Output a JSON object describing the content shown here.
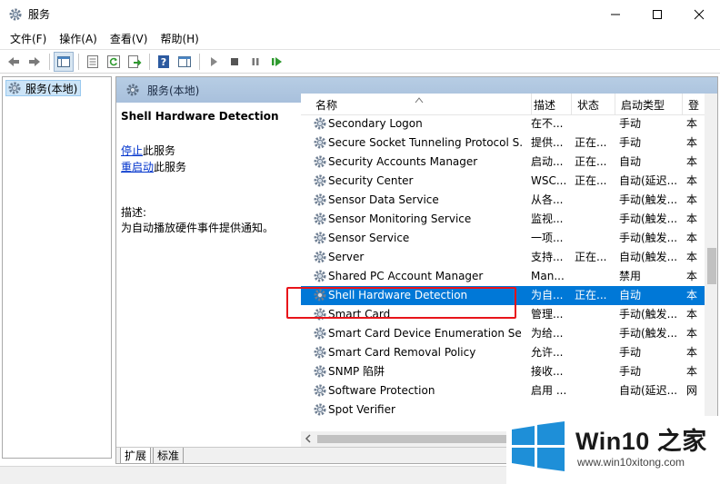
{
  "window": {
    "title": "服务",
    "minimize": "—",
    "maximize": "☐",
    "close": "✕"
  },
  "menu": [
    "文件(F)",
    "操作(A)",
    "查看(V)",
    "帮助(H)"
  ],
  "tree": {
    "root": "服务(本地)"
  },
  "panel": {
    "header": "服务(本地)",
    "service_title": "Shell Hardware Detection",
    "stop_link": "停止",
    "stop_suffix": "此服务",
    "restart_link": "重启动",
    "restart_suffix": "此服务",
    "desc_label": "描述:",
    "desc_text": "为自动播放硬件事件提供通知。"
  },
  "columns": [
    "名称",
    "描述",
    "状态",
    "启动类型",
    "登"
  ],
  "rows": [
    {
      "name": "Secondary Logon",
      "desc": "在不...",
      "status": "",
      "startup": "手动",
      "logon": "本"
    },
    {
      "name": "Secure Socket Tunneling Protocol S...",
      "desc": "提供...",
      "status": "正在...",
      "startup": "手动",
      "logon": "本"
    },
    {
      "name": "Security Accounts Manager",
      "desc": "启动...",
      "status": "正在...",
      "startup": "自动",
      "logon": "本"
    },
    {
      "name": "Security Center",
      "desc": "WSC...",
      "status": "正在...",
      "startup": "自动(延迟...",
      "logon": "本"
    },
    {
      "name": "Sensor Data Service",
      "desc": "从各...",
      "status": "",
      "startup": "手动(触发...",
      "logon": "本"
    },
    {
      "name": "Sensor Monitoring Service",
      "desc": "监视...",
      "status": "",
      "startup": "手动(触发...",
      "logon": "本"
    },
    {
      "name": "Sensor Service",
      "desc": "一项...",
      "status": "",
      "startup": "手动(触发...",
      "logon": "本"
    },
    {
      "name": "Server",
      "desc": "支持...",
      "status": "正在...",
      "startup": "自动(触发...",
      "logon": "本"
    },
    {
      "name": "Shared PC Account Manager",
      "desc": "Man...",
      "status": "",
      "startup": "禁用",
      "logon": "本"
    },
    {
      "name": "Shell Hardware Detection",
      "desc": "为自...",
      "status": "正在...",
      "startup": "自动",
      "logon": "本",
      "selected": true
    },
    {
      "name": "Smart Card",
      "desc": "管理...",
      "status": "",
      "startup": "手动(触发...",
      "logon": "本"
    },
    {
      "name": "Smart Card Device Enumeration Se...",
      "desc": "为给...",
      "status": "",
      "startup": "手动(触发...",
      "logon": "本"
    },
    {
      "name": "Smart Card Removal Policy",
      "desc": "允许...",
      "status": "",
      "startup": "手动",
      "logon": "本"
    },
    {
      "name": "SNMP 陷阱",
      "desc": "接收...",
      "status": "",
      "startup": "手动",
      "logon": "本"
    },
    {
      "name": "Software Protection",
      "desc": "启用 ...",
      "status": "",
      "startup": "自动(延迟...",
      "logon": "网"
    },
    {
      "name": "Spot Verifier",
      "desc": "",
      "status": "",
      "startup": "",
      "logon": ""
    }
  ],
  "tabs": [
    "扩展",
    "标准"
  ],
  "watermark": {
    "brand": "Win10",
    "brand_zh": "之家",
    "url": "www.win10xitong.com"
  },
  "colors": {
    "selected_row": "#0078d7",
    "highlight_box": "#e8141a",
    "panel_header": "#b0c7e1",
    "link": "#0033cc"
  }
}
